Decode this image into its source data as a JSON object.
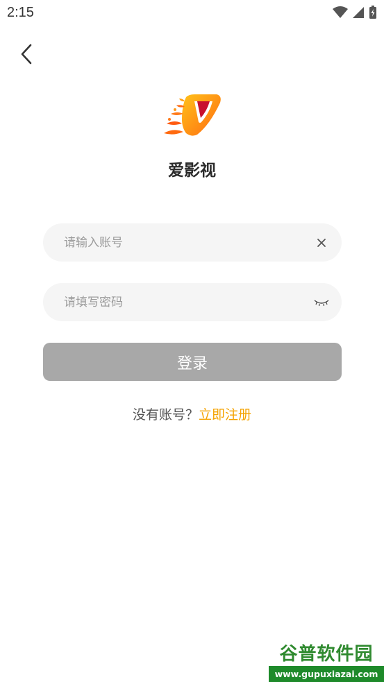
{
  "status_bar": {
    "time": "2:15",
    "icons": [
      "wifi-icon",
      "signal-icon",
      "battery-charging-icon"
    ]
  },
  "header": {
    "back_icon": "chevron-left-icon"
  },
  "app": {
    "name": "爱影视",
    "logo_icon": "flaming-play-logo"
  },
  "form": {
    "account": {
      "placeholder": "请输入账号",
      "value": "",
      "clear_icon": "close-icon"
    },
    "password": {
      "placeholder": "请填写密码",
      "value": "",
      "toggle_icon": "eye-closed-icon"
    },
    "login_label": "登录"
  },
  "register": {
    "prompt": "没有账号？",
    "link": "立即注册"
  },
  "watermark": {
    "title": "谷普软件园",
    "url": "www.gupuxiazai.com"
  },
  "colors": {
    "accent": "#f5a300",
    "button_disabled": "#a8a8a8",
    "field_bg": "#f5f5f5",
    "logo_orange": "#ff7a1a",
    "logo_yellow": "#ffc21a",
    "watermark_green": "#1e8a2a"
  }
}
